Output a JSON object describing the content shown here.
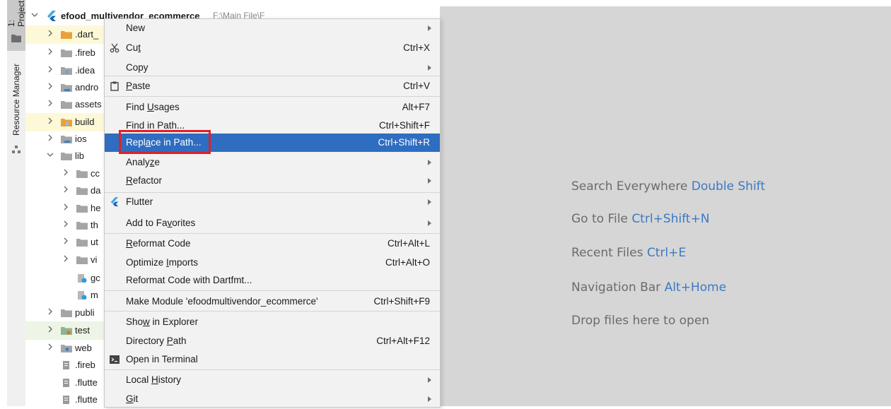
{
  "strip": {
    "project_label": "1: Project",
    "resource_label": "Resource Manager"
  },
  "tree": {
    "root": {
      "name": "efood_multivendor_ecommerce",
      "path": "F:\\Main File\\F"
    },
    "items": [
      {
        "label": ".dart_",
        "icon": "folder-orange-icon",
        "expanded": false
      },
      {
        "label": ".fireb",
        "icon": "folder-icon",
        "expanded": false
      },
      {
        "label": ".idea",
        "icon": "folder-config-icon",
        "expanded": false
      },
      {
        "label": "andro",
        "icon": "folder-module-icon",
        "expanded": false
      },
      {
        "label": "assets",
        "icon": "folder-icon",
        "expanded": false
      },
      {
        "label": "build",
        "icon": "folder-orange-config-icon",
        "expanded": false
      },
      {
        "label": "ios",
        "icon": "folder-module-icon",
        "expanded": false
      },
      {
        "label": "lib",
        "icon": "folder-icon",
        "expanded": true
      },
      {
        "label": "cc",
        "icon": "folder-icon",
        "expanded": false
      },
      {
        "label": "da",
        "icon": "folder-icon",
        "expanded": false
      },
      {
        "label": "he",
        "icon": "folder-icon",
        "expanded": false
      },
      {
        "label": "th",
        "icon": "folder-icon",
        "expanded": false
      },
      {
        "label": "ut",
        "icon": "folder-icon",
        "expanded": false
      },
      {
        "label": "vi",
        "icon": "folder-icon",
        "expanded": false
      },
      {
        "label": "gc",
        "icon": "dart-file-icon"
      },
      {
        "label": "m",
        "icon": "dart-file-icon"
      },
      {
        "label": "publi",
        "icon": "folder-icon",
        "expanded": false
      },
      {
        "label": "test",
        "icon": "folder-test-icon",
        "expanded": false
      },
      {
        "label": "web",
        "icon": "folder-web-icon",
        "expanded": false
      },
      {
        "label": ".fireb",
        "icon": "file-icon"
      },
      {
        "label": ".flutte",
        "icon": "file-icon"
      },
      {
        "label": ".flutte",
        "icon": "file-icon"
      }
    ]
  },
  "menu": {
    "items": [
      {
        "label": "New",
        "submenu": true
      },
      {
        "label": "Cut",
        "shortcut": "Ctrl+X",
        "icon": "scissors-icon"
      },
      {
        "label": "Copy",
        "submenu": true
      },
      {
        "label": "Paste",
        "shortcut": "Ctrl+V",
        "icon": "clipboard-icon"
      },
      {
        "label": "Find Usages",
        "shortcut": "Alt+F7"
      },
      {
        "label": "Find in Path...",
        "shortcut": "Ctrl+Shift+F"
      },
      {
        "label": "Replace in Path...",
        "shortcut": "Ctrl+Shift+R",
        "selected": true
      },
      {
        "label": "Analyze",
        "submenu": true
      },
      {
        "label": "Refactor",
        "submenu": true
      },
      {
        "label": "Flutter",
        "submenu": true,
        "icon": "flutter-icon"
      },
      {
        "label": "Add to Favorites",
        "submenu": true
      },
      {
        "label": "Reformat Code",
        "shortcut": "Ctrl+Alt+L"
      },
      {
        "label": "Optimize Imports",
        "shortcut": "Ctrl+Alt+O"
      },
      {
        "label": "Reformat Code with Dartfmt..."
      },
      {
        "label": "Make Module 'efoodmultivendor_ecommerce'",
        "shortcut": "Ctrl+Shift+F9"
      },
      {
        "label": "Show in Explorer"
      },
      {
        "label": "Directory Path",
        "shortcut": "Ctrl+Alt+F12"
      },
      {
        "label": "Open in Terminal",
        "icon": "terminal-icon"
      },
      {
        "label": "Local History",
        "submenu": true
      },
      {
        "label": "Git",
        "submenu": true
      }
    ]
  },
  "editor": {
    "hints": [
      {
        "text": "Search Everywhere",
        "key": "Double Shift"
      },
      {
        "text": "Go to File",
        "key": "Ctrl+Shift+N"
      },
      {
        "text": "Recent Files",
        "key": "Ctrl+E"
      },
      {
        "text": "Navigation Bar",
        "key": "Alt+Home"
      },
      {
        "text": "Drop files here to open",
        "key": ""
      }
    ]
  },
  "colors": {
    "selection": "#2e6dc0",
    "highlight_box": "#e0202a",
    "hint_key": "#3b79c4"
  }
}
